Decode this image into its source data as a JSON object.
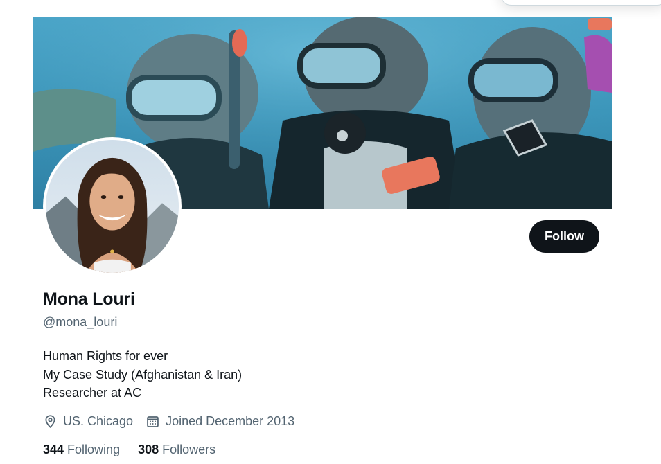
{
  "profile": {
    "name": "Mona Louri",
    "handle": "@mona_louri",
    "bio_lines": [
      "Human Rights for ever",
      "My Case Study (Afghanistan & Iran)",
      "Researcher at AC"
    ],
    "location": "US. Chicago",
    "joined": "Joined December 2013",
    "following_count": "344",
    "following_label": "Following",
    "followers_count": "308",
    "followers_label": "Followers"
  },
  "actions": {
    "follow_label": "Follow"
  },
  "icons": {
    "location": "location-pin-icon",
    "joined": "calendar-icon"
  },
  "colors": {
    "text_primary": "#0f1419",
    "text_secondary": "#536471",
    "button_bg": "#0f1419",
    "banner_water": "#3a9cc0"
  }
}
